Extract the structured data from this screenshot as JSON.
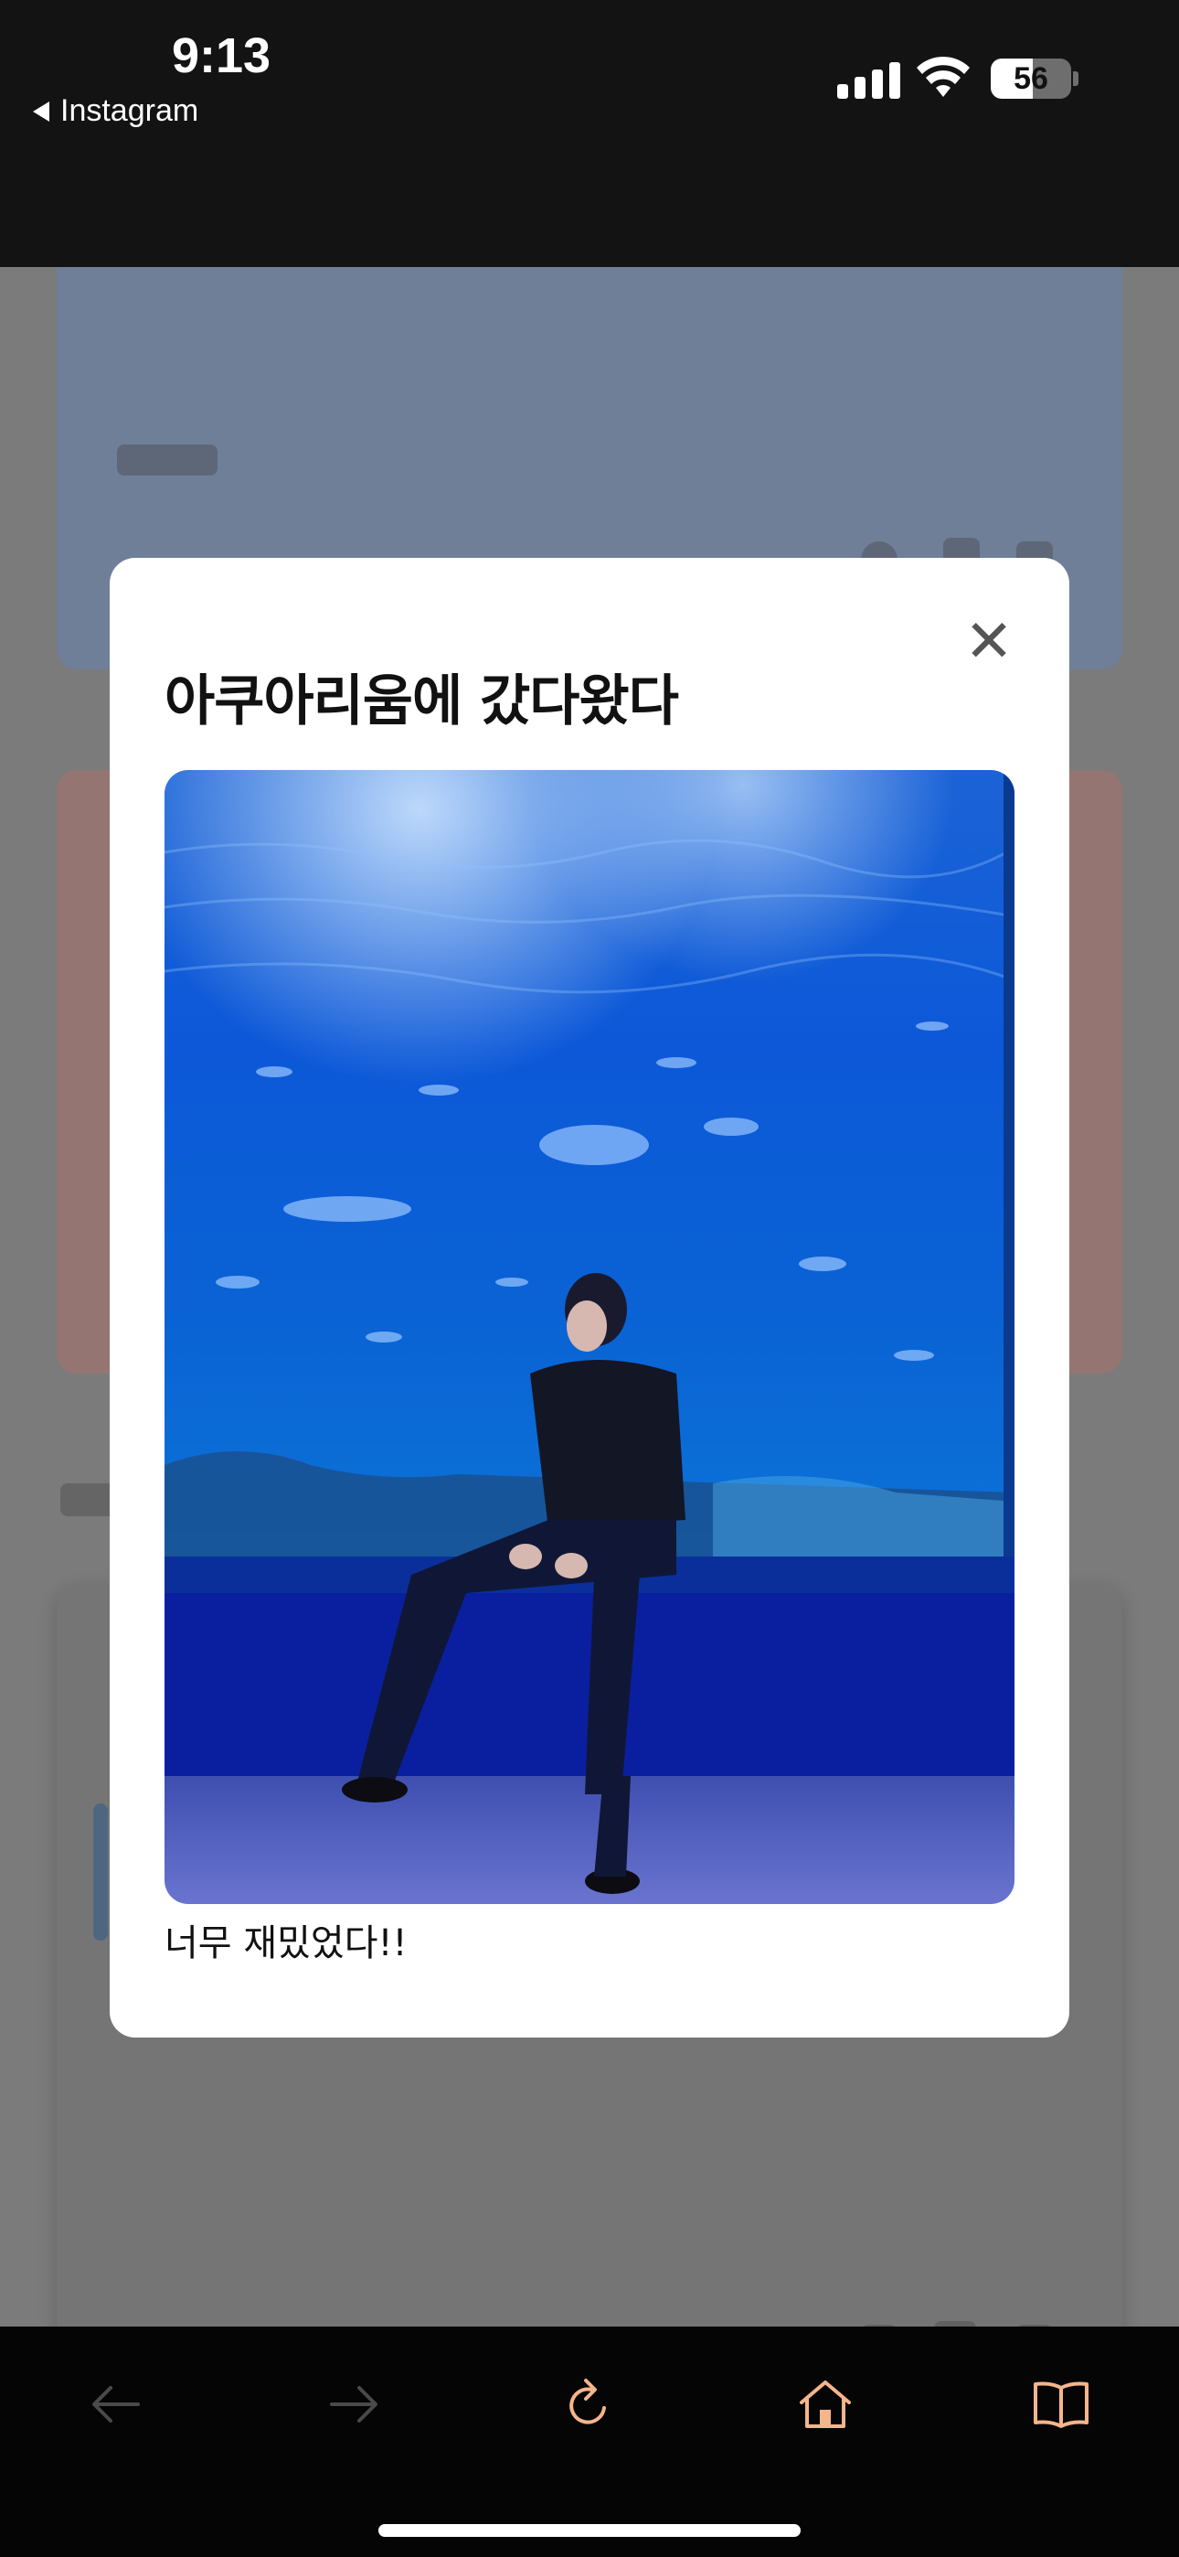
{
  "status_bar": {
    "time": "9:13",
    "back_app_label": "Instagram",
    "battery_level": "56",
    "signal_bars": 4
  },
  "modal": {
    "title": "아쿠아리움에 갔다왔다",
    "close_glyph": "✕",
    "photo_icon": "aquarium-photo",
    "caption": "너무 재밌었다!!"
  },
  "toolbar": {
    "back_icon": "arrow-left-icon",
    "forward_icon": "arrow-right-icon",
    "reload_icon": "reload-icon",
    "home_icon": "home-icon",
    "bookmarks_icon": "book-icon",
    "accent_color": "#f5b58b",
    "disabled_color": "#4a4a4a"
  },
  "colors": {
    "status_bg": "#131313",
    "overlay_bg": "#7a7a7a",
    "modal_bg": "#ffffff",
    "toolbar_bg": "#050505"
  }
}
